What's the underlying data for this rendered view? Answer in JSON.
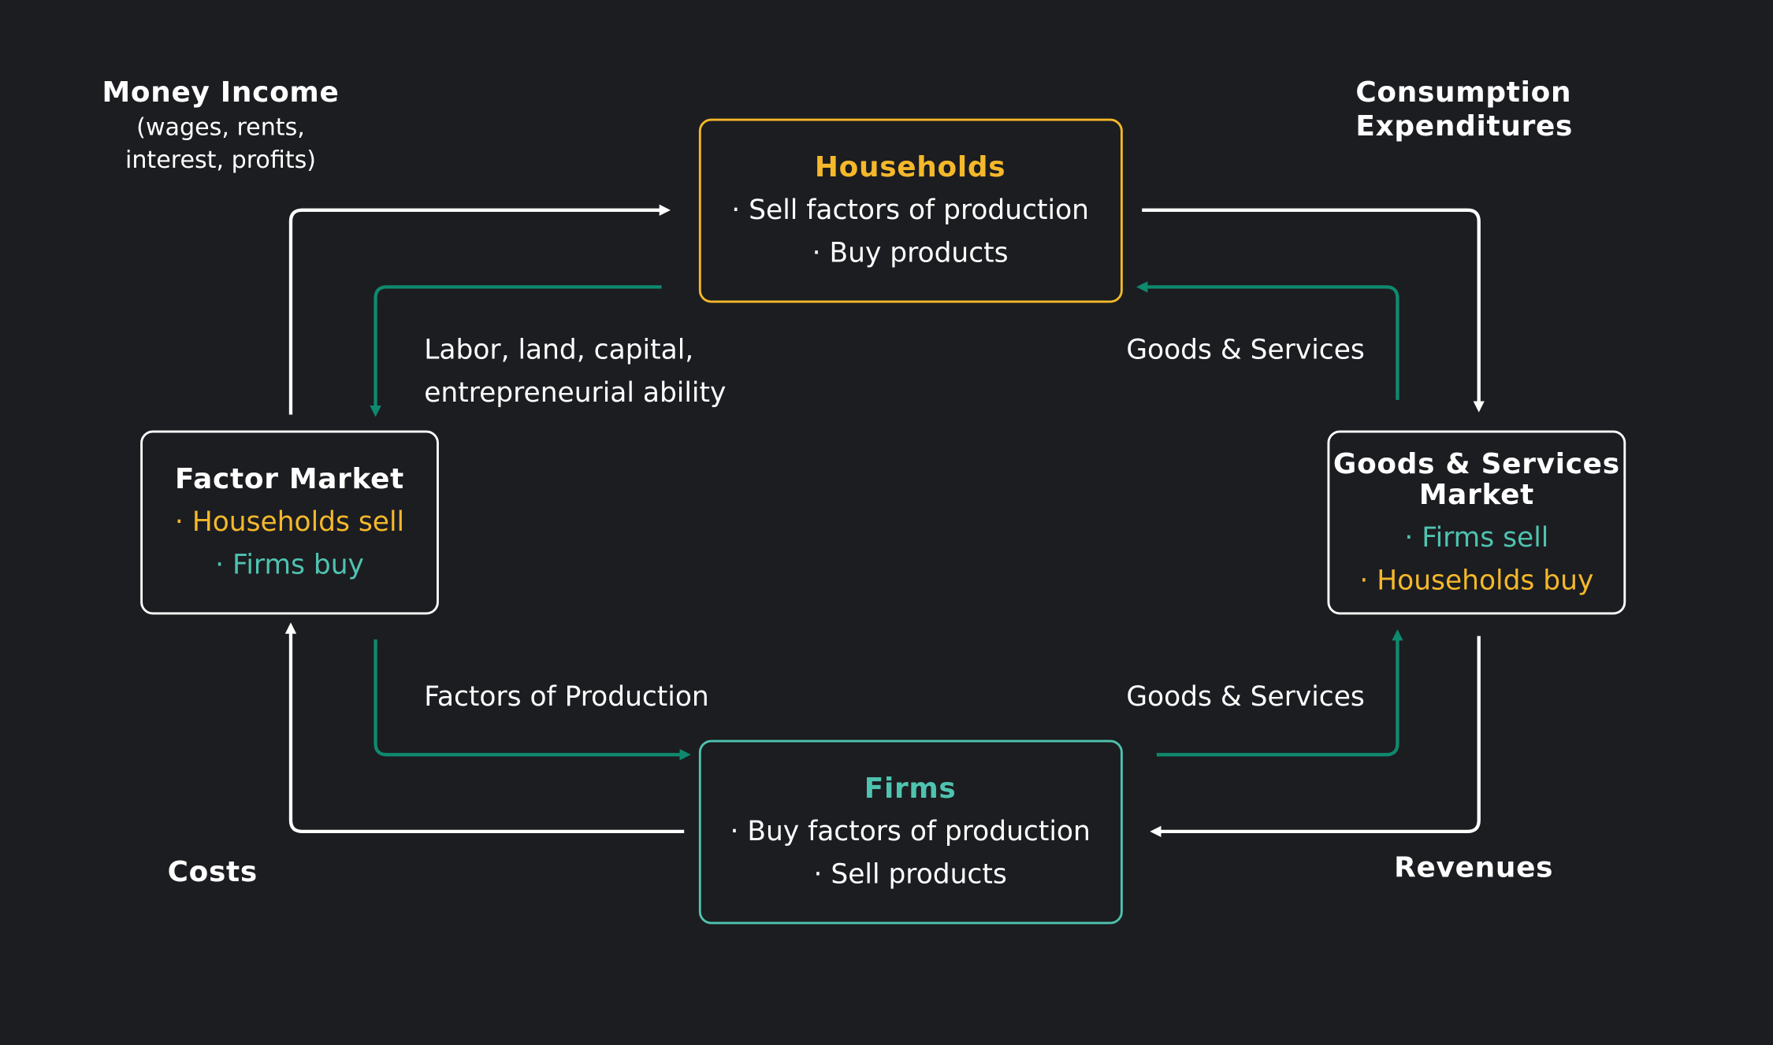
{
  "colors": {
    "background": "#1c1d21",
    "households": "#f5b82a",
    "firms": "#4fc3b0",
    "money_flow": "#ffffff",
    "real_flow": "#0e8a6e"
  },
  "households": {
    "title": "Households",
    "lines": [
      "· Sell factors of production",
      "· Buy products"
    ]
  },
  "factor_market": {
    "title": "Factor Market",
    "lines": [
      "· Households sell",
      "· Firms buy"
    ]
  },
  "goods_market": {
    "title_lines": [
      "Goods & Services",
      "Market"
    ],
    "lines": [
      "· Firms sell",
      "· Households buy"
    ]
  },
  "firms": {
    "title": "Firms",
    "lines": [
      "· Buy factors of production",
      "· Sell products"
    ]
  },
  "labels": {
    "money_income": "Money Income",
    "money_income_sub": [
      "(wages, rents,",
      "interest, profits)"
    ],
    "consumption": [
      "Consumption",
      "Expenditures"
    ],
    "labor": [
      "Labor, land, capital,",
      "entrepreneurial ability"
    ],
    "goods_top": "Goods & Services",
    "goods_bottom": "Goods & Services",
    "factors": "Factors of Production",
    "costs": "Costs",
    "revenues": "Revenues"
  }
}
